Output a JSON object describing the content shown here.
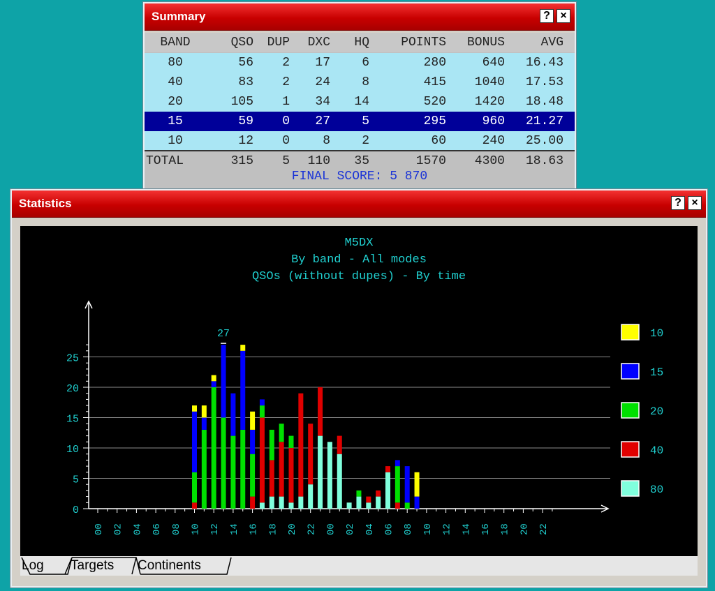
{
  "summary": {
    "title": "Summary",
    "help_label": "?",
    "close_label": "×",
    "headers": [
      "BAND",
      "QSO",
      "DUP",
      "DXC",
      "HQ",
      "POINTS",
      "BONUS",
      "AVG"
    ],
    "rows": [
      [
        "80",
        "56",
        "2",
        "17",
        "6",
        "280",
        "640",
        "16.43"
      ],
      [
        "40",
        "83",
        "2",
        "24",
        "8",
        "415",
        "1040",
        "17.53"
      ],
      [
        "20",
        "105",
        "1",
        "34",
        "14",
        "520",
        "1420",
        "18.48"
      ],
      [
        "15",
        "59",
        "0",
        "27",
        "5",
        "295",
        "960",
        "21.27"
      ],
      [
        "10",
        "12",
        "0",
        "8",
        "2",
        "60",
        "240",
        "25.00"
      ]
    ],
    "selected_row": 3,
    "total": [
      "TOTAL",
      "315",
      "5",
      "110",
      "35",
      "1570",
      "4300",
      "18.63"
    ],
    "final_score": "FINAL SCORE: 5 870"
  },
  "statistics": {
    "title": "Statistics",
    "help_label": "?",
    "close_label": "×",
    "tabs": [
      "Log",
      "Targets",
      "Continents"
    ],
    "active_tab": 0,
    "colors": {
      "10": "#ffff00",
      "15": "#0000ff",
      "20": "#00e000",
      "40": "#e00000",
      "80": "#80ffdd"
    },
    "chart_data": {
      "type": "bar",
      "stacked": true,
      "title": "M5DX",
      "subtitle": [
        "By band - All modes",
        "QSOs (without dupes) - By time"
      ],
      "x_ticks": [
        "00",
        "02",
        "04",
        "06",
        "08",
        "10",
        "12",
        "14",
        "16",
        "18",
        "20",
        "22",
        "00",
        "02",
        "04",
        "06",
        "08",
        "10",
        "12",
        "14",
        "16",
        "18",
        "20",
        "22"
      ],
      "ylim": [
        0,
        30
      ],
      "y_ticks": [
        0,
        5,
        10,
        15,
        20,
        25
      ],
      "grid": true,
      "legend_position": "right",
      "max_label": "27",
      "series_order": [
        "80",
        "40",
        "20",
        "15",
        "10"
      ],
      "bars": [
        {
          "hour": 10,
          "80": 0,
          "40": 1,
          "20": 5,
          "15": 10,
          "10": 1
        },
        {
          "hour": 11,
          "80": 0,
          "40": 0,
          "20": 13,
          "15": 2,
          "10": 2
        },
        {
          "hour": 12,
          "80": 0,
          "40": 0,
          "20": 20,
          "15": 1,
          "10": 1
        },
        {
          "hour": 13,
          "80": 0,
          "40": 0,
          "20": 15,
          "15": 12,
          "10": 0
        },
        {
          "hour": 14,
          "80": 0,
          "40": 0,
          "20": 12,
          "15": 7,
          "10": 0
        },
        {
          "hour": 15,
          "80": 0,
          "40": 0,
          "20": 13,
          "15": 13,
          "10": 1
        },
        {
          "hour": 16,
          "80": 0,
          "40": 2,
          "20": 7,
          "15": 4,
          "10": 3
        },
        {
          "hour": 17,
          "80": 1,
          "40": 14,
          "20": 2,
          "15": 1,
          "10": 0
        },
        {
          "hour": 18,
          "80": 2,
          "40": 6,
          "20": 5,
          "15": 0,
          "10": 0
        },
        {
          "hour": 19,
          "80": 2,
          "40": 9,
          "20": 3,
          "15": 0,
          "10": 0
        },
        {
          "hour": 20,
          "80": 1,
          "40": 9,
          "20": 2,
          "15": 0,
          "10": 0
        },
        {
          "hour": 21,
          "80": 2,
          "40": 17,
          "20": 0,
          "15": 0,
          "10": 0
        },
        {
          "hour": 22,
          "80": 4,
          "40": 10,
          "20": 0,
          "15": 0,
          "10": 0
        },
        {
          "hour": 23,
          "80": 12,
          "40": 8,
          "20": 0,
          "15": 0,
          "10": 0
        },
        {
          "hour": 24,
          "80": 11,
          "40": 0,
          "20": 0,
          "15": 0,
          "10": 0
        },
        {
          "hour": 25,
          "80": 9,
          "40": 3,
          "20": 0,
          "15": 0,
          "10": 0
        },
        {
          "hour": 26,
          "80": 1,
          "40": 0,
          "20": 0,
          "15": 0,
          "10": 0
        },
        {
          "hour": 27,
          "80": 2,
          "40": 0,
          "20": 1,
          "15": 0,
          "10": 0
        },
        {
          "hour": 28,
          "80": 1,
          "40": 1,
          "20": 0,
          "15": 0,
          "10": 0
        },
        {
          "hour": 29,
          "80": 2,
          "40": 1,
          "20": 0,
          "15": 0,
          "10": 0
        },
        {
          "hour": 30,
          "80": 6,
          "40": 1,
          "20": 0,
          "15": 0,
          "10": 0
        },
        {
          "hour": 31,
          "80": 0,
          "40": 1,
          "20": 6,
          "15": 1,
          "10": 0
        },
        {
          "hour": 32,
          "80": 0,
          "40": 0,
          "20": 1,
          "15": 6,
          "10": 0
        },
        {
          "hour": 33,
          "80": 0,
          "40": 0,
          "20": 0,
          "15": 2,
          "10": 4
        }
      ],
      "legend": [
        "10",
        "15",
        "20",
        "40",
        "80"
      ]
    }
  }
}
